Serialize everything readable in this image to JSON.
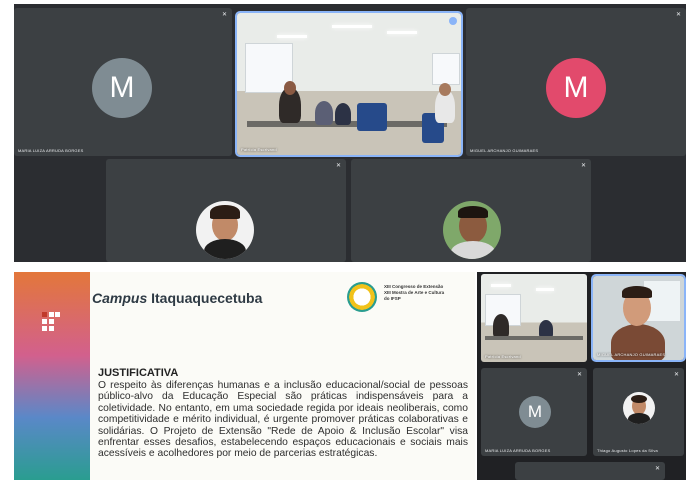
{
  "meeting_top": {
    "participants": [
      {
        "name": "MARIA LUIZA ARRUDA BORGES",
        "initial": "M",
        "avatar_color": "#7f8c93",
        "mic": "muted"
      },
      {
        "name": "Patrícia Escrivand",
        "video": "classroom",
        "mic": "speaking"
      },
      {
        "name": "MIGUEL ARCHANJO GUIMARAES",
        "initial": "M",
        "avatar_color": "#e24a6c",
        "mic": "muted"
      },
      {
        "name": "",
        "video": "avatar-photo",
        "mic": "muted"
      },
      {
        "name": "",
        "video": "avatar-photo",
        "mic": "muted"
      }
    ]
  },
  "slide": {
    "title_italic": "Campus",
    "title_rest": " Itaquaquecetuba",
    "congress": [
      "XIII Congresso de Extensão",
      "XIII Mostra de Arte e Cultura",
      "do IFSP"
    ],
    "heading": "JUSTIFICATIVA",
    "body": "O respeito às diferenças humanas e a inclusão educacional/social de pessoas público-alvo da Educação Especial são práticas indispensáveis para a coletividade. No entanto, em uma sociedade regida por ideais neoliberais, como competitividade e mérito individual, é urgente promover práticas colaborativas e solidárias. O Projeto de Extensão \"Rede de Apoio & Inclusão Escolar\" visa enfrentar esses desafios, estabelecendo espaços educacionais e sociais mais acessíveis e acolhedores por meio de parcerias estratégicas."
  },
  "meeting_bottom": {
    "participants": [
      {
        "name": "Patrícia Escrivand",
        "video": "classroom"
      },
      {
        "name": "MIGUEL ARCHANJO GUIMARAES",
        "video": "webcam"
      },
      {
        "name": "MARIA LUIZA ARRUDA BORGES",
        "initial": "M",
        "avatar_color": "#7f8c93"
      },
      {
        "name": "Thiago Augusto Lopes da Silva",
        "video": "avatar-photo"
      }
    ]
  },
  "colors": {
    "panel_bg": "#2b2d31",
    "tile_bg": "#3c4043",
    "active_outline": "#8ab4f8"
  }
}
